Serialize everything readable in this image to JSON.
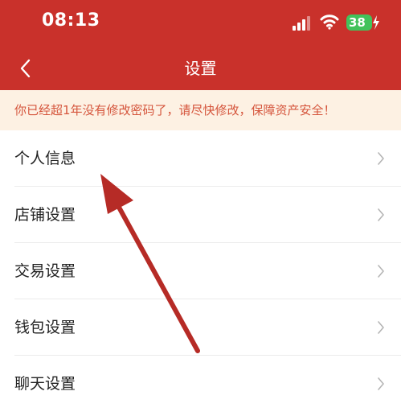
{
  "status_bar": {
    "time": "08:13",
    "battery": "38"
  },
  "nav": {
    "title": "设置"
  },
  "notice": {
    "text": "你已经超1年没有修改密码了，请尽快修改，保障资产安全！"
  },
  "menu": {
    "items": [
      {
        "label": "个人信息"
      },
      {
        "label": "店铺设置"
      },
      {
        "label": "交易设置"
      },
      {
        "label": "钱包设置"
      },
      {
        "label": "聊天设置"
      }
    ]
  },
  "colors": {
    "header": "#c9312b",
    "notice_bg": "#fdf1e3",
    "notice_text": "#d5553c",
    "battery": "#42c25b",
    "annotation_arrow": "#b62b26"
  },
  "icons": {
    "back": "chevron-left-icon",
    "item_chevron": "chevron-right-icon",
    "signal": "cellular-signal-icon",
    "wifi": "wifi-icon",
    "battery": "battery-icon"
  }
}
